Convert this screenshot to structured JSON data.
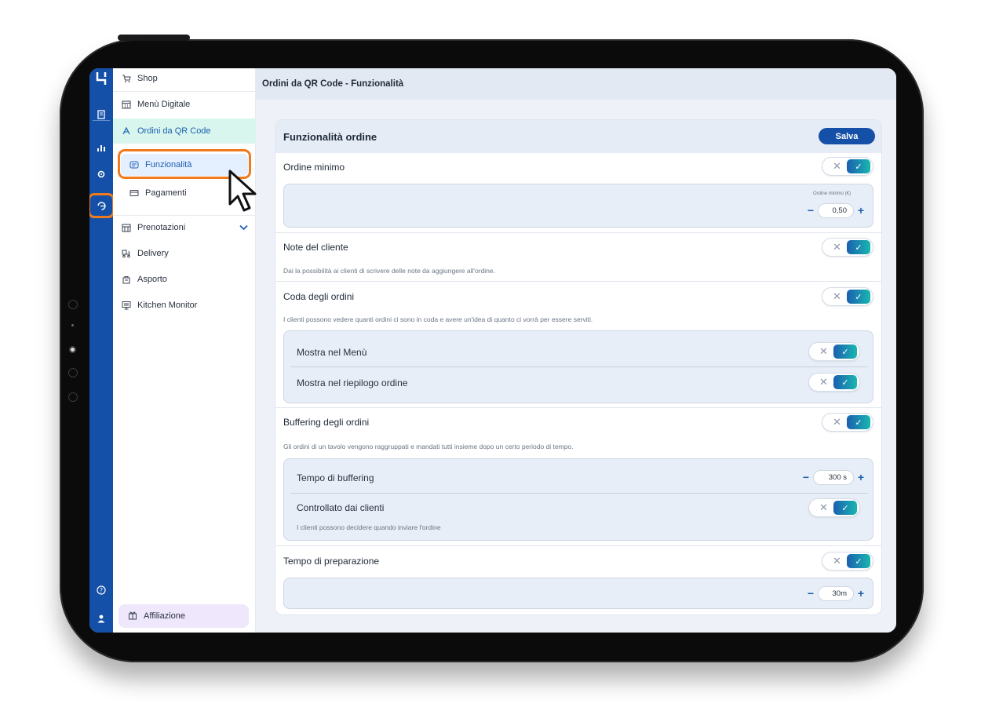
{
  "sidebar": {
    "items": [
      {
        "label": "Shop",
        "icon": "cart-icon"
      },
      {
        "label": "Menù Digitale",
        "icon": "calendar-icon"
      },
      {
        "label": "Ordini da QR Code",
        "icon": "qr-order-icon"
      }
    ],
    "subitems": [
      {
        "label": "Funzionalità",
        "icon": "feature-icon"
      },
      {
        "label": "Pagamenti",
        "icon": "card-icon"
      }
    ],
    "items2": [
      {
        "label": "Prenotazioni",
        "icon": "calendar-grid-icon"
      },
      {
        "label": "Delivery",
        "icon": "scooter-icon"
      },
      {
        "label": "Asporto",
        "icon": "bag-icon"
      },
      {
        "label": "Kitchen Monitor",
        "icon": "monitor-icon"
      }
    ],
    "affiliazione": "Affiliazione"
  },
  "topbar": {
    "title": "Ordini da QR Code - Funzionalità"
  },
  "card": {
    "title": "Funzionalità ordine",
    "save_label": "Salva",
    "ordine_minimo": {
      "title": "Ordine minimo",
      "field_label": "Ordine minimo (€)",
      "value": "0,50"
    },
    "note_cliente": {
      "title": "Note del cliente",
      "desc": "Dai la possibilità ai clienti di scrivere delle note da aggiungere all'ordine."
    },
    "coda_ordini": {
      "title": "Coda degli ordini",
      "desc": "I clienti possono vedere quanti ordini ci sono in coda e avere un'idea di quanto ci vorrà per essere serviti.",
      "sub1": "Mostra nel Menù",
      "sub2": "Mostra nel riepilogo ordine"
    },
    "buffering": {
      "title": "Buffering degli ordini",
      "desc": "Gli ordini di un tavolo vengono raggruppati e mandati tutti insieme dopo un certo periodo di tempo.",
      "tempo_label": "Tempo di buffering",
      "tempo_value": "300 s",
      "controllato_label": "Controllato dai clienti",
      "controllato_desc": "I clienti possono decidere quando inviare l'ordine"
    },
    "preparazione": {
      "title": "Tempo di preparazione",
      "value": "30m"
    },
    "toggle_off_symbol": "✕",
    "toggle_on_symbol": "✓",
    "minus": "−",
    "plus": "+"
  },
  "colors": {
    "brand": "#1550a8",
    "accent": "#19b7b0",
    "highlight": "#f07b1e"
  }
}
